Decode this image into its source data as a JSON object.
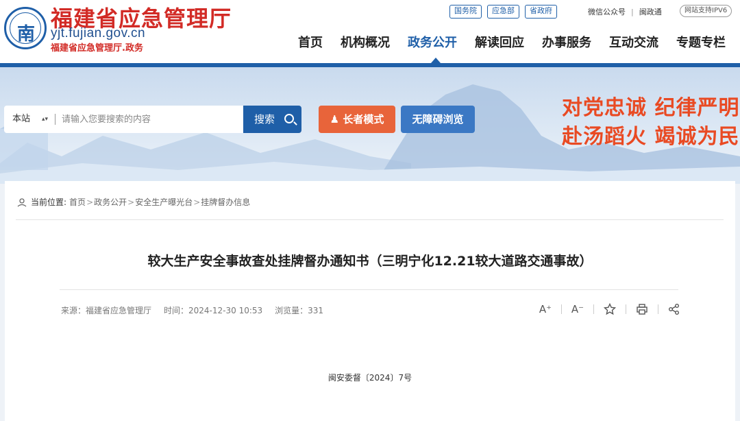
{
  "header": {
    "site_title": "福建省应急管理厅",
    "domain": "yjt.fujian.gov.cn",
    "subtitle": "福建省应急管理厅.政务",
    "top_links": [
      "国务院",
      "应急部",
      "省政府"
    ],
    "wechat": "微信公众号",
    "minzhengtong": "闽政通",
    "ipv6": "网站支持IPV6"
  },
  "nav": {
    "items": [
      {
        "label": "首页",
        "active": false
      },
      {
        "label": "机构概况",
        "active": false
      },
      {
        "label": "政务公开",
        "active": true
      },
      {
        "label": "解读回应",
        "active": false
      },
      {
        "label": "办事服务",
        "active": false
      },
      {
        "label": "互动交流",
        "active": false
      },
      {
        "label": "专题专栏",
        "active": false
      }
    ]
  },
  "search": {
    "scope": "本站",
    "placeholder": "请输入您要搜索的内容",
    "button": "搜索"
  },
  "modes": {
    "elder": "长者模式",
    "accessible": "无障碍浏览"
  },
  "slogans": [
    "对党忠诚 纪律严明",
    "赴汤蹈火 竭诚为民"
  ],
  "breadcrumb": {
    "label": "当前位置:",
    "items": [
      "首页",
      "政务公开",
      "安全生产曝光台",
      "挂牌督办信息"
    ]
  },
  "article": {
    "title": "较大生产安全事故查处挂牌督办通知书（三明宁化12.21较大道路交通事故）",
    "source": "来源：福建省应急管理厅",
    "time": "时间：2024-12-30 10:53",
    "views": "浏览量：331",
    "doc_number": "闽安委督〔2024〕7号"
  },
  "tools": {
    "font_up": "A⁺",
    "font_down": "A⁻"
  },
  "colors": {
    "brand_blue": "#1f5fa8",
    "brand_red": "#d22b26",
    "slogan_orange": "#e94a23",
    "elder_orange": "#e8643a"
  }
}
